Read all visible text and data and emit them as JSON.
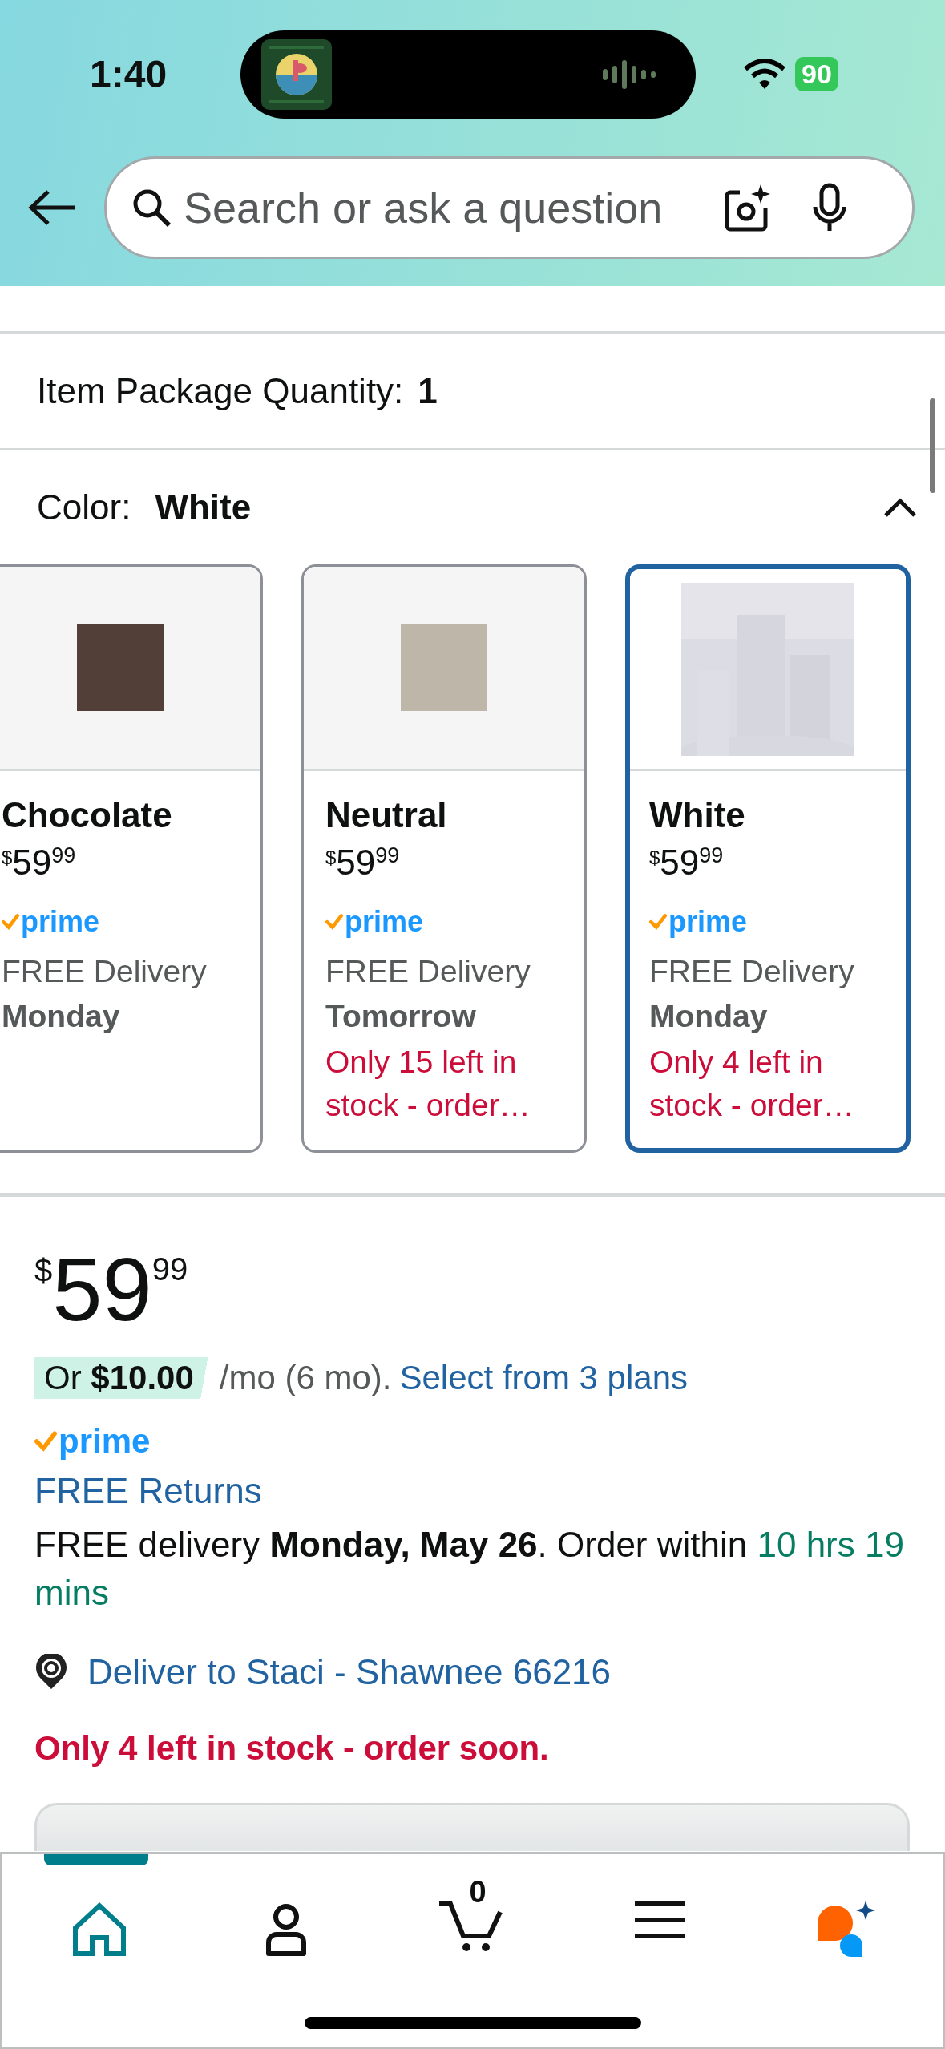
{
  "status_bar": {
    "time": "1:40",
    "battery": "90"
  },
  "search": {
    "placeholder": "Search or ask a question"
  },
  "quantity": {
    "label": "Item Package Quantity:",
    "value": "1"
  },
  "color_selector": {
    "label": "Color:",
    "value": "White",
    "expanded": true,
    "options": [
      {
        "kind": "swatch",
        "color": "#523f38",
        "name": "Chocolate",
        "price": {
          "currency": "$",
          "whole": "59",
          "fraction": "99"
        },
        "prime": "prime",
        "delivery": "FREE Delivery",
        "day": "Monday",
        "selected": false
      },
      {
        "kind": "swatch",
        "color": "#bfb6aa",
        "name": "Neutral",
        "price": {
          "currency": "$",
          "whole": "59",
          "fraction": "99"
        },
        "prime": "prime",
        "delivery": "FREE Delivery",
        "day": "Tomorrow",
        "stock": "Only 15 left in stock - order…",
        "selected": false
      },
      {
        "kind": "picture",
        "name": "White",
        "price": {
          "currency": "$",
          "whole": "59",
          "fraction": "99"
        },
        "prime": "prime",
        "delivery": "FREE Delivery",
        "day": "Monday",
        "stock": "Only 4 left in stock - order…",
        "selected": true
      }
    ]
  },
  "price": {
    "currency": "$",
    "whole": "59",
    "fraction": "99"
  },
  "financing": {
    "amount": "Or **$10.00**",
    "terms": "/mo (6 mo).",
    "link": "Select from 3 plans"
  },
  "prime": "prime",
  "returns_link": "FREE Returns",
  "delivery": {
    "text": "FREE delivery **Monday, May 26**. Order within",
    "countdown": "10 hrs 19 mins"
  },
  "deliver_to": "Deliver to Staci - Shawnee 66216",
  "stock": "Only 4 left in stock - order soon.",
  "nav": [
    {
      "kind": "home",
      "selected": true
    },
    {
      "kind": "account",
      "selected": false
    },
    {
      "kind": "cart",
      "count": "0",
      "selected": false
    },
    {
      "kind": "menu",
      "selected": false
    },
    {
      "kind": "assistant",
      "selected": false
    }
  ]
}
